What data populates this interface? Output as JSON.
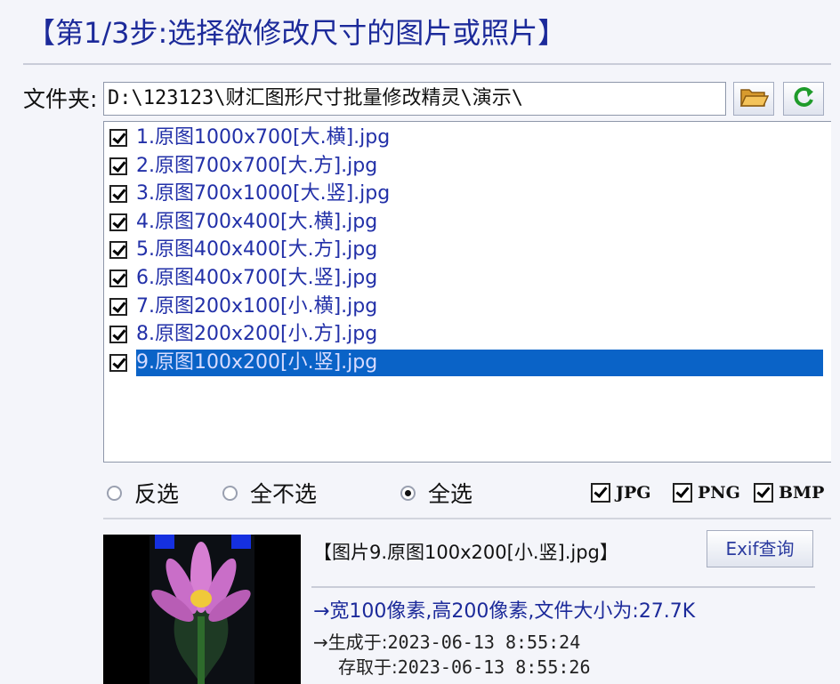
{
  "step_title": "【第1/3步:选择欲修改尺寸的图片或照片】",
  "folder": {
    "label": "文件夹:",
    "path": "D:\\123123\\财汇图形尺寸批量修改精灵\\演示\\"
  },
  "toolbar": {
    "open_icon": "folder-open-icon",
    "refresh_icon": "refresh-icon"
  },
  "files": [
    {
      "name": "1.原图1000x700[大.横].jpg",
      "checked": true,
      "selected": false
    },
    {
      "name": "2.原图700x700[大.方].jpg",
      "checked": true,
      "selected": false
    },
    {
      "name": "3.原图700x1000[大.竖].jpg",
      "checked": true,
      "selected": false
    },
    {
      "name": "4.原图700x400[大.横].jpg",
      "checked": true,
      "selected": false
    },
    {
      "name": "5.原图400x400[大.方].jpg",
      "checked": true,
      "selected": false
    },
    {
      "name": "6.原图400x700[大.竖].jpg",
      "checked": true,
      "selected": false
    },
    {
      "name": "7.原图200x100[小.横].jpg",
      "checked": true,
      "selected": false
    },
    {
      "name": "8.原图200x200[小.方].jpg",
      "checked": true,
      "selected": false
    },
    {
      "name": "9.原图100x200[小.竖].jpg",
      "checked": true,
      "selected": true
    }
  ],
  "selection": {
    "invert": "反选",
    "none": "全不选",
    "all": "全选",
    "current": "all"
  },
  "formats": [
    {
      "label": "JPG",
      "checked": true
    },
    {
      "label": "PNG",
      "checked": true
    },
    {
      "label": "BMP",
      "checked": true
    }
  ],
  "preview": {
    "caption": "【图片9.原图100x200[小.竖].jpg】",
    "exif_button": "Exif查询",
    "summary": "→宽100像素,高200像素,文件大小为:27.7K",
    "created_label": "→生成于:",
    "created": "2023-06-13 8:55:24",
    "accessed_label": "存取于:",
    "accessed": "2023-06-13 8:55:26"
  },
  "colors": {
    "title": "#1c2a9a",
    "file_text": "#2230a8",
    "selection": "#0a63c7"
  }
}
